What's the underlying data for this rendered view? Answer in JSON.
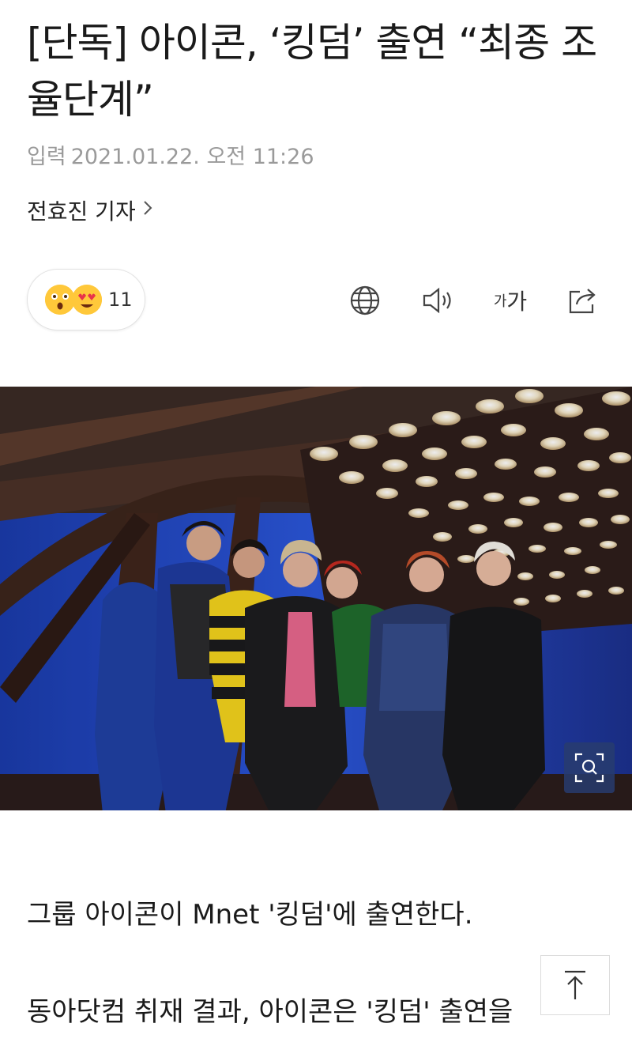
{
  "article": {
    "headline": "[단독] 아이콘, ‘킹덤’ 출연 “최종 조율단계”",
    "date_label": "입력",
    "date_value": "2021.01.22. 오전 11:26",
    "reporter": "전효진 기자",
    "paragraphs": [
      "그룹 아이콘이 Mnet '킹덤'에 출연한다.",
      "동아닷컴 취재 결과, 아이콘은 '킹덤' 출연을"
    ]
  },
  "reactions": {
    "count": "11",
    "icons": [
      "surprised-emoji-icon",
      "heart-eyes-emoji-icon"
    ]
  },
  "toolbar": {
    "icons": [
      "globe-icon",
      "speaker-icon",
      "font-size-icon",
      "share-icon"
    ],
    "font_size_small": "가",
    "font_size_large": "가"
  },
  "colors": {
    "emoji_yellow": "#ffc83a",
    "text_muted": "#9a9a9a",
    "zoom_button": "#283c6e"
  }
}
